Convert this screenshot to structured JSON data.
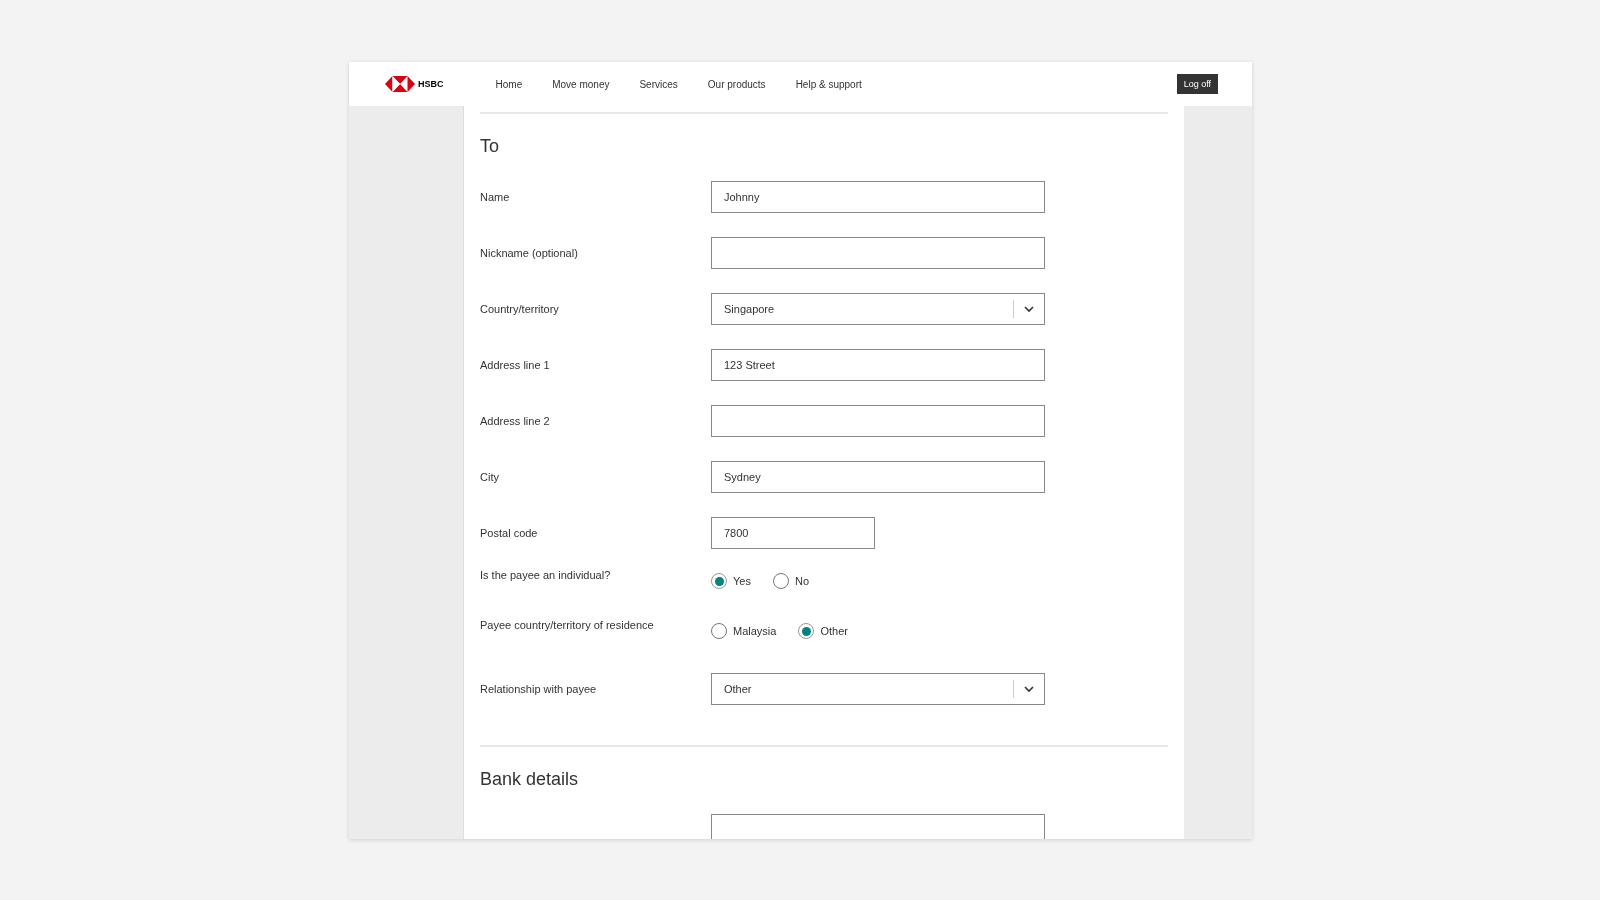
{
  "header": {
    "logo_text": "HSBC",
    "nav": [
      {
        "label": "Home"
      },
      {
        "label": "Move money"
      },
      {
        "label": "Services"
      },
      {
        "label": "Our products"
      },
      {
        "label": "Help & support"
      }
    ],
    "logoff": "Log off"
  },
  "sections": [
    {
      "title": "To",
      "fields": [
        {
          "kind": "text",
          "label": "Name",
          "value": "Johnny"
        },
        {
          "kind": "text",
          "label": "Nickname (optional)"
        },
        {
          "kind": "select",
          "label": "Country/territory",
          "value": "Singapore"
        },
        {
          "kind": "text",
          "label": "Address line 1",
          "value": "123 Street"
        },
        {
          "kind": "text",
          "label": "Address line 2"
        },
        {
          "kind": "text",
          "label": "City",
          "value": "Sydney"
        },
        {
          "kind": "short",
          "label": "Postal code",
          "value": "7800"
        },
        {
          "kind": "radio",
          "label": "Is the payee an individual?",
          "options": [
            {
              "label": "Yes",
              "selected": true
            },
            {
              "label": "No",
              "selected": false
            }
          ]
        },
        {
          "kind": "radio",
          "label": "Payee country/territory of residence",
          "options": [
            {
              "label": "Malaysia",
              "selected": false
            },
            {
              "label": "Other",
              "selected": true
            }
          ]
        },
        {
          "kind": "select",
          "label": "Relationship with payee",
          "value": "Other"
        }
      ]
    },
    {
      "title": "Bank details",
      "fields": [
        {
          "kind": "text"
        }
      ]
    }
  ]
}
